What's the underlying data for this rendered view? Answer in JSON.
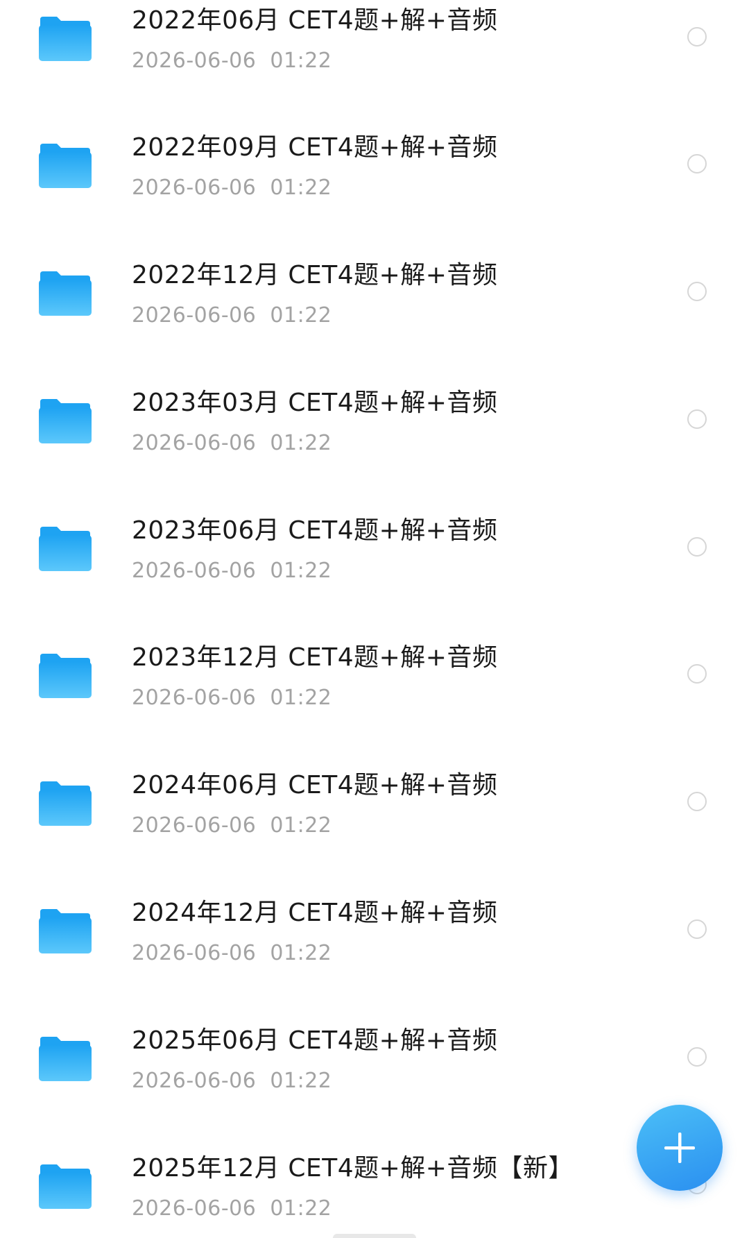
{
  "colors": {
    "folder_light": "#5cc8fb",
    "folder_dark": "#1ea3f2",
    "fab": "#2a8ff0",
    "name_text": "#1a1a1a",
    "date_text": "#a3a3a3"
  },
  "files": [
    {
      "name": "2022年06月 CET4题+解+音频",
      "date": "2026-06-06  01:22",
      "icon": "folder-icon"
    },
    {
      "name": "2022年09月 CET4题+解+音频",
      "date": "2026-06-06  01:22",
      "icon": "folder-icon"
    },
    {
      "name": "2022年12月 CET4题+解+音频",
      "date": "2026-06-06  01:22",
      "icon": "folder-icon"
    },
    {
      "name": "2023年03月 CET4题+解+音频",
      "date": "2026-06-06  01:22",
      "icon": "folder-icon"
    },
    {
      "name": "2023年06月 CET4题+解+音频",
      "date": "2026-06-06  01:22",
      "icon": "folder-icon"
    },
    {
      "name": "2023年12月 CET4题+解+音频",
      "date": "2026-06-06  01:22",
      "icon": "folder-icon"
    },
    {
      "name": "2024年06月 CET4题+解+音频",
      "date": "2026-06-06  01:22",
      "icon": "folder-icon"
    },
    {
      "name": "2024年12月 CET4题+解+音频",
      "date": "2026-06-06  01:22",
      "icon": "folder-icon"
    },
    {
      "name": "2025年06月 CET4题+解+音频",
      "date": "2026-06-06  01:22",
      "icon": "folder-icon"
    },
    {
      "name": "2025年12月 CET4题+解+音频【新】",
      "date": "2026-06-06  01:22",
      "icon": "folder-icon"
    }
  ],
  "fab": {
    "icon": "plus-icon"
  }
}
